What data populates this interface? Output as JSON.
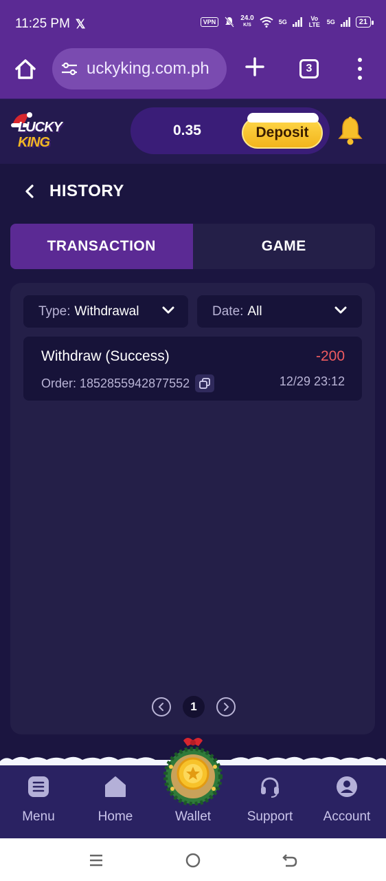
{
  "status_bar": {
    "time": "11:25 PM",
    "x_logo": "𝕏",
    "vpn": "VPN",
    "speed_value": "24.0",
    "speed_unit": "K/S",
    "network_1": "5G",
    "network_2": "Vo LTE",
    "network_3": "5G",
    "battery": "21"
  },
  "browser": {
    "url": "uckyking.com.ph",
    "tab_count": "3"
  },
  "header": {
    "logo_lucky": "LUCKY",
    "logo_king": "KING",
    "balance": "0.35",
    "deposit_label": "Deposit"
  },
  "page": {
    "title": "HISTORY"
  },
  "tabs": [
    {
      "label": "TRANSACTION",
      "active": true
    },
    {
      "label": "GAME",
      "active": false
    }
  ],
  "filters": {
    "type_label": "Type:",
    "type_value": "Withdrawal",
    "date_label": "Date:",
    "date_value": "All"
  },
  "transactions": [
    {
      "title": "Withdraw (Success)",
      "amount": "-200",
      "order": "Order: 1852855942877552",
      "date": "12/29 23:12"
    }
  ],
  "pagination": {
    "current_page": "1"
  },
  "bottom_nav": [
    {
      "label": "Menu",
      "icon": "menu-icon"
    },
    {
      "label": "Home",
      "icon": "home-icon"
    },
    {
      "label": "Wallet",
      "icon": "wallet-coin-icon"
    },
    {
      "label": "Support",
      "icon": "headset-icon"
    },
    {
      "label": "Account",
      "icon": "account-icon"
    }
  ],
  "colors": {
    "brand_purple": "#5b2a94",
    "background": "#1b1540",
    "panel": "#241f48",
    "negative_amount": "#ef5b60",
    "deposit_gold": "#f2b41c"
  }
}
